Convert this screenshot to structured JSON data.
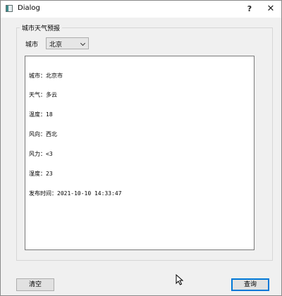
{
  "window": {
    "title": "Dialog",
    "help_glyph": "?",
    "close_glyph": "✕"
  },
  "group": {
    "title": "城市天气预报",
    "city_label": "城市",
    "city_selected": "北京"
  },
  "output": {
    "lines": [
      "城市：北京市",
      "天气：多云",
      "温度：18",
      "风向：西北",
      "风力：<3",
      "湿度：23",
      "发布时间：2021-10-10 14:33:47"
    ]
  },
  "buttons": {
    "clear_label": "清空",
    "query_label": "查询"
  },
  "icons": {
    "app": "dialog-app-icon",
    "help": "help-icon",
    "close": "close-icon",
    "dropdown": "chevron-down-icon",
    "pointer": "mouse-cursor-icon"
  }
}
